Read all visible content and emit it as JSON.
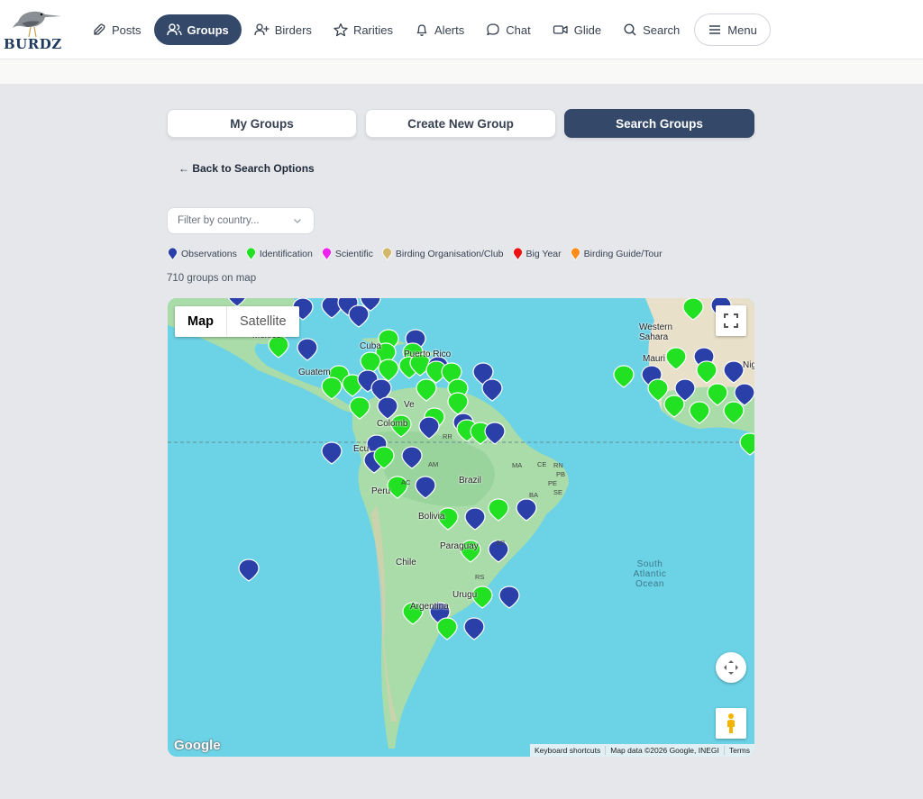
{
  "app": {
    "logo_text": "BURDZ"
  },
  "nav": {
    "posts": "Posts",
    "groups": "Groups",
    "birders": "Birders",
    "rarities": "Rarities",
    "alerts": "Alerts",
    "chat": "Chat",
    "glide": "Glide",
    "search": "Search",
    "menu": "Menu"
  },
  "tabs": {
    "my_groups": "My Groups",
    "create_group": "Create New Group",
    "search_groups": "Search Groups"
  },
  "back_link": "← Back to Search Options",
  "filter": {
    "placeholder": "Filter by country..."
  },
  "legend": [
    {
      "label": "Observations",
      "color": "#2a3fa8"
    },
    {
      "label": "Identification",
      "color": "#22e022"
    },
    {
      "label": "Scientific",
      "color": "#ee22ee"
    },
    {
      "label": "Birding Organisation/Club",
      "color": "#d4b86a"
    },
    {
      "label": "Big Year",
      "color": "#ee1111"
    },
    {
      "label": "Birding Guide/Tour",
      "color": "#ff8c1a"
    }
  ],
  "group_count": "710 groups on map",
  "map": {
    "type_map": "Map",
    "type_satellite": "Satellite",
    "google": "Google",
    "attribution": {
      "shortcuts": "Keyboard shortcuts",
      "data": "Map data ©2026 Google, INEGI",
      "terms": "Terms"
    },
    "labels": {
      "mexico": "Mexico",
      "cuba": "Cuba",
      "puerto_rico": "Puerto Rico",
      "guatemala": "Guatem",
      "venezuela": "Ve",
      "colombia": "Colomb",
      "ecuador": "Ecu",
      "peru": "Peru",
      "brazil": "Brazil",
      "bolivia": "Bolivia",
      "paraguay": "Paraguay",
      "chile": "Chile",
      "uruguay": "Urugu",
      "argentina": "Argentina",
      "western_sahara": "Western Sahara",
      "mauritania": "Mauri",
      "niger": "Nig",
      "south_atlantic": "South Atlantic Ocean",
      "state_am": "AM",
      "state_ac": "AC",
      "state_ma": "MA",
      "state_ce": "CE",
      "state_rn": "RN",
      "state_pb": "PB",
      "state_pe": "PE",
      "state_ba": "BA",
      "state_se": "SE",
      "state_sp": "SP",
      "state_rs": "RS",
      "state_rr": "RR"
    }
  }
}
